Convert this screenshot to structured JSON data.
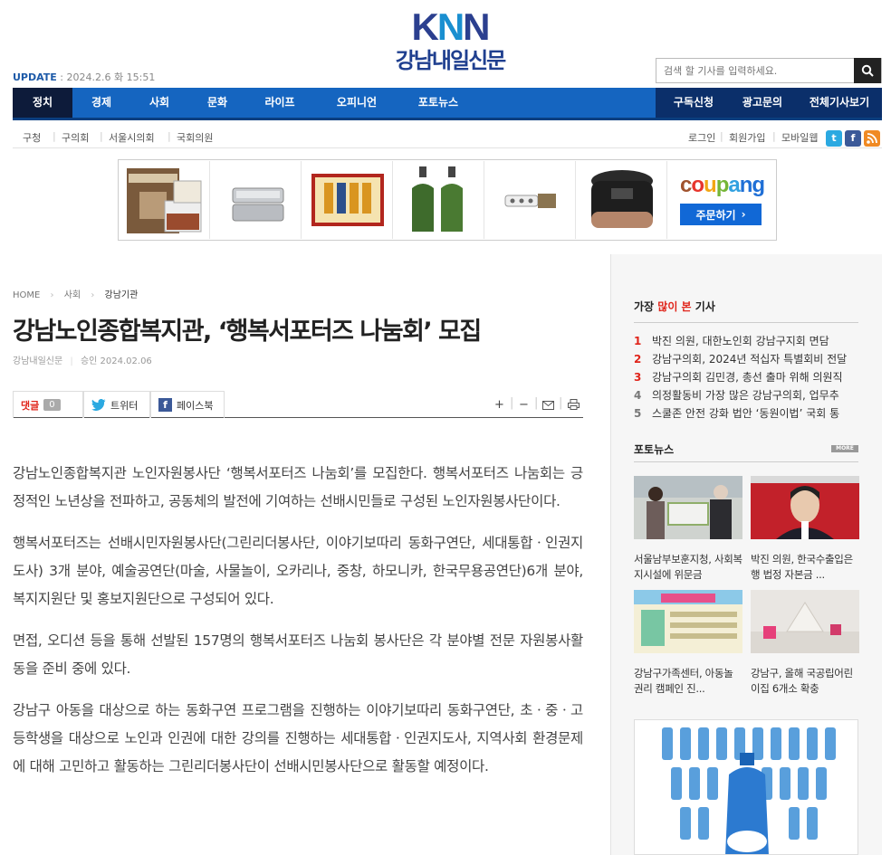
{
  "header": {
    "logo_text": "KNN",
    "paper_name": "강남내일신문",
    "update_label": "UPDATE",
    "update_time": "2024.2.6 화 15:51",
    "search_placeholder": "검색 할 기사를 입력하세요."
  },
  "nav": {
    "items": [
      "정치",
      "경제",
      "사회",
      "문화",
      "라이프",
      "오피니언",
      "포토뉴스"
    ],
    "right_items": [
      "구독신청",
      "광고문의",
      "전체기사보기"
    ]
  },
  "subnav": {
    "items": [
      "구청",
      "구의회",
      "서울시의회",
      "국회의원"
    ],
    "right_links": [
      "로그인",
      "회원가입",
      "모바일웹"
    ]
  },
  "ad": {
    "brand": "coupang",
    "button": "주문하기"
  },
  "breadcrumb": [
    "HOME",
    "사회",
    "강남기관"
  ],
  "article": {
    "title": "강남노인종합복지관, ‘행복서포터즈 나눔회’ 모집",
    "source": "강남내일신문",
    "approved": "승인 2024.02.06",
    "comment_label": "댓글",
    "comment_count": "0",
    "twitter_label": "트위터",
    "facebook_label": "페이스북",
    "paragraphs": [
      "강남노인종합복지관 노인자원봉사단 ‘행복서포터즈 나눔회’를 모집한다. 행복서포터즈 나눔회는 긍정적인 노년상을 전파하고, 공동체의 발전에 기여하는 선배시민들로 구성된 노인자원봉사단이다.",
      "행복서포터즈는 선배시민자원봉사단(그린리더봉사단, 이야기보따리 동화구연단, 세대통합ㆍ인권지도사) 3개 분야, 예술공연단(마술, 사물놀이, 오카리나, 중창, 하모니카, 한국무용공연단)6개 분야, 복지지원단 및 홍보지원단으로 구성되어 있다.",
      "면접, 오디션 등을 통해 선발된 157명의 행복서포터즈 나눔회 봉사단은 각 분야별 전문 자원봉사활동을 준비 중에 있다.",
      "강남구 아동을 대상으로 하는 동화구연 프로그램을 진행하는 이야기보따리 동화구연단, 초ㆍ중ㆍ고등학생을 대상으로 노인과 인권에 대한 강의를 진행하는 세대통합ㆍ인권지도사, 지역사회 환경문제에 대해 고민하고 활동하는 그린리더봉사단이 선배시민봉사단으로 활동할 예정이다."
    ]
  },
  "sidebar": {
    "popular_title_a": "가장",
    "popular_title_b": "많이 본",
    "popular_title_c": "기사",
    "popular": [
      {
        "rank": "1",
        "text": "박진 의원, 대한노인회 강남구지회 면담"
      },
      {
        "rank": "2",
        "text": "강남구의회, 2024년 적십자 특별회비 전달"
      },
      {
        "rank": "3",
        "text": "강남구의회 김민경, 총선 출마 위해 의원직"
      },
      {
        "rank": "4",
        "text": "의정활동비 가장 많은 강남구의회, 업무추"
      },
      {
        "rank": "5",
        "text": "스쿨존 안전 강화 법안 ‘동원이법’ 국회 통"
      }
    ],
    "photo_title": "포토뉴스",
    "more_label": "MORE",
    "photos": [
      {
        "caption": "서울남부보훈지청, 사회복지시설에 위문금"
      },
      {
        "caption": "박진 의원, 한국수출입은행 법정 자본금 ..."
      },
      {
        "caption": "강남구가족센터, 아동놀 권리 캠페인 진..."
      },
      {
        "caption": "강남구, 올해 국공립어린이집 6개소 확충"
      }
    ]
  },
  "colors": {
    "nav_blue": "#1565c0",
    "nav_active": "#0d1b3a",
    "accent_red": "#e0251b"
  }
}
